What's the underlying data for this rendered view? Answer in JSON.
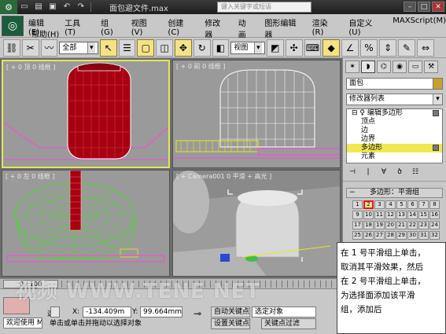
{
  "titlebar": {
    "title": "面包避文件.max",
    "search_placeholder": "键入关键字或短语",
    "min": "–",
    "max": "□",
    "close": "✕"
  },
  "menu": {
    "row1": [
      "编辑(E)",
      "工具(T)",
      "组(G)",
      "视图(V)",
      "创建(C)",
      "修改器",
      "动画",
      "图形编辑器",
      "渲染(R)",
      "自定义(U)",
      "MAXScript(M)"
    ],
    "row2": [
      "帮助(H)"
    ]
  },
  "toolbar": {
    "selection_filter": "全部",
    "ref_coord": "视图"
  },
  "viewports": {
    "top_left": "[ + 0 顶 0 线框 ]",
    "top_right": "[ + 0 前 0 线框 ]",
    "bottom_left": "[ + 0 左 0 线框 ]",
    "bottom_right": "[ + Camera001 0 平滑 + 高光 ]"
  },
  "command_panel": {
    "object_name": "面包",
    "modifier_list": "修改器列表",
    "stack": [
      {
        "label": "编辑多边形",
        "level": 0,
        "selected": false
      },
      {
        "label": "顶点",
        "level": 1,
        "selected": false
      },
      {
        "label": "边",
        "level": 1,
        "selected": false
      },
      {
        "label": "边界",
        "level": 1,
        "selected": false
      },
      {
        "label": "多边形",
        "level": 1,
        "selected": true
      },
      {
        "label": "元素",
        "level": 1,
        "selected": false
      }
    ],
    "rollout_title": "多边形：平滑组",
    "smoothing_groups": [
      "1",
      "2",
      "3",
      "4",
      "5",
      "6",
      "7",
      "8",
      "9",
      "10",
      "11",
      "12",
      "13",
      "14",
      "15",
      "16",
      "17",
      "18",
      "19",
      "20",
      "21",
      "22",
      "23",
      "24",
      "25",
      "26",
      "27",
      "28",
      "29",
      "30",
      "31",
      "32"
    ],
    "active_group": "2"
  },
  "tip": {
    "lines": [
      "在 1 号平滑组上单击，",
      "取消其平滑效果，然后",
      "在 2 号平滑组上单击，",
      "为选择面添加该平滑",
      "组，添加后"
    ]
  },
  "timebar": {
    "frame": "0 / 100"
  },
  "status": {
    "welcome": "欢迎使用 M",
    "x_label": "X:",
    "y_label": "Y:",
    "x_value": "-134.409m",
    "y_value": "99.664mm",
    "auto_key": "自动关键点",
    "set_key": "设置关键点",
    "selected_object": "选定对象",
    "key_filter": "关键点过滤",
    "prompt": "单击或单击并拖动以选择对象",
    "sel_label": "选"
  },
  "watermark": "视频 WWW.TENE NET",
  "colors": {
    "bread_red": "#a80010",
    "wire_green": "#44dd22",
    "selection_yellow": "#f0e850",
    "pink_ground": "#e060c8"
  }
}
